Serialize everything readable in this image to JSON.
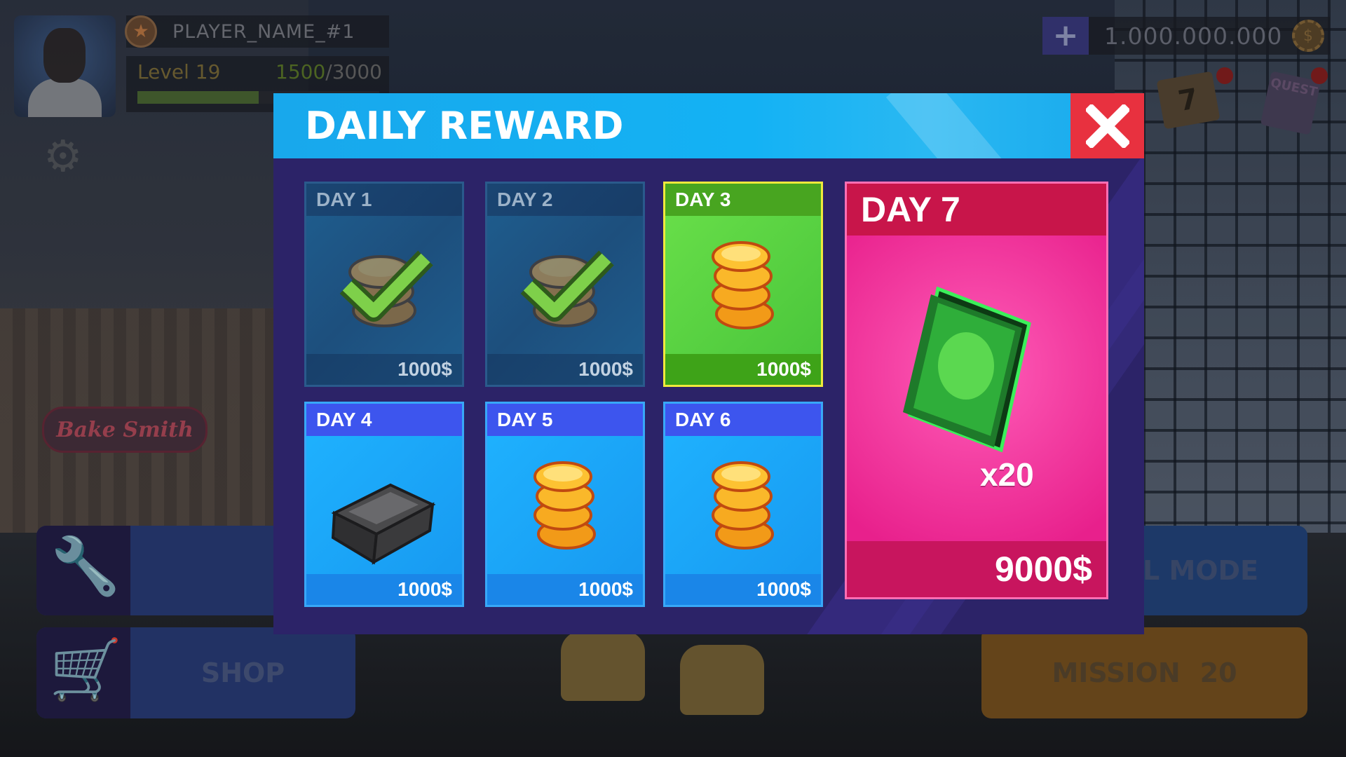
{
  "hud": {
    "player_name": "PLAYER_NAME_#1",
    "level_label": "Level 19",
    "xp_current": "1500",
    "xp_max": "/3000",
    "xp_progress": 0.5,
    "currency_value": "1.000.000.000",
    "plus_label": "+",
    "calendar_day": "7",
    "quest_label": "QUEST"
  },
  "background": {
    "sign_text": "Bake Smith"
  },
  "menu": {
    "shop_label": "SHOP",
    "mode_label": "L MODE",
    "mission_label": "MISSION",
    "mission_number": "20"
  },
  "modal": {
    "title": "DAILY REWARD",
    "close_icon": "close-x-icon",
    "days": [
      {
        "label": "DAY 1",
        "price": "1000$",
        "state": "claimed",
        "reward": "coins"
      },
      {
        "label": "DAY 2",
        "price": "1000$",
        "state": "claimed",
        "reward": "coins"
      },
      {
        "label": "DAY 3",
        "price": "1000$",
        "state": "today",
        "reward": "coins"
      },
      {
        "label": "DAY 4",
        "price": "1000$",
        "state": "locked",
        "reward": "silver-bar"
      },
      {
        "label": "DAY 5",
        "price": "1000$",
        "state": "locked",
        "reward": "coins"
      },
      {
        "label": "DAY 6",
        "price": "1000$",
        "state": "locked",
        "reward": "coins"
      }
    ],
    "big_day": {
      "label": "DAY 7",
      "price": "9000$",
      "multiplier": "x20",
      "reward": "green-card-pack"
    }
  },
  "colors": {
    "header_blue": "#18a8ec",
    "close_red": "#e8313f",
    "modal_bg": "#2c2368",
    "today_green": "#48c43a",
    "future_blue": "#1fb3ff",
    "big_pink": "#ff5db8"
  }
}
